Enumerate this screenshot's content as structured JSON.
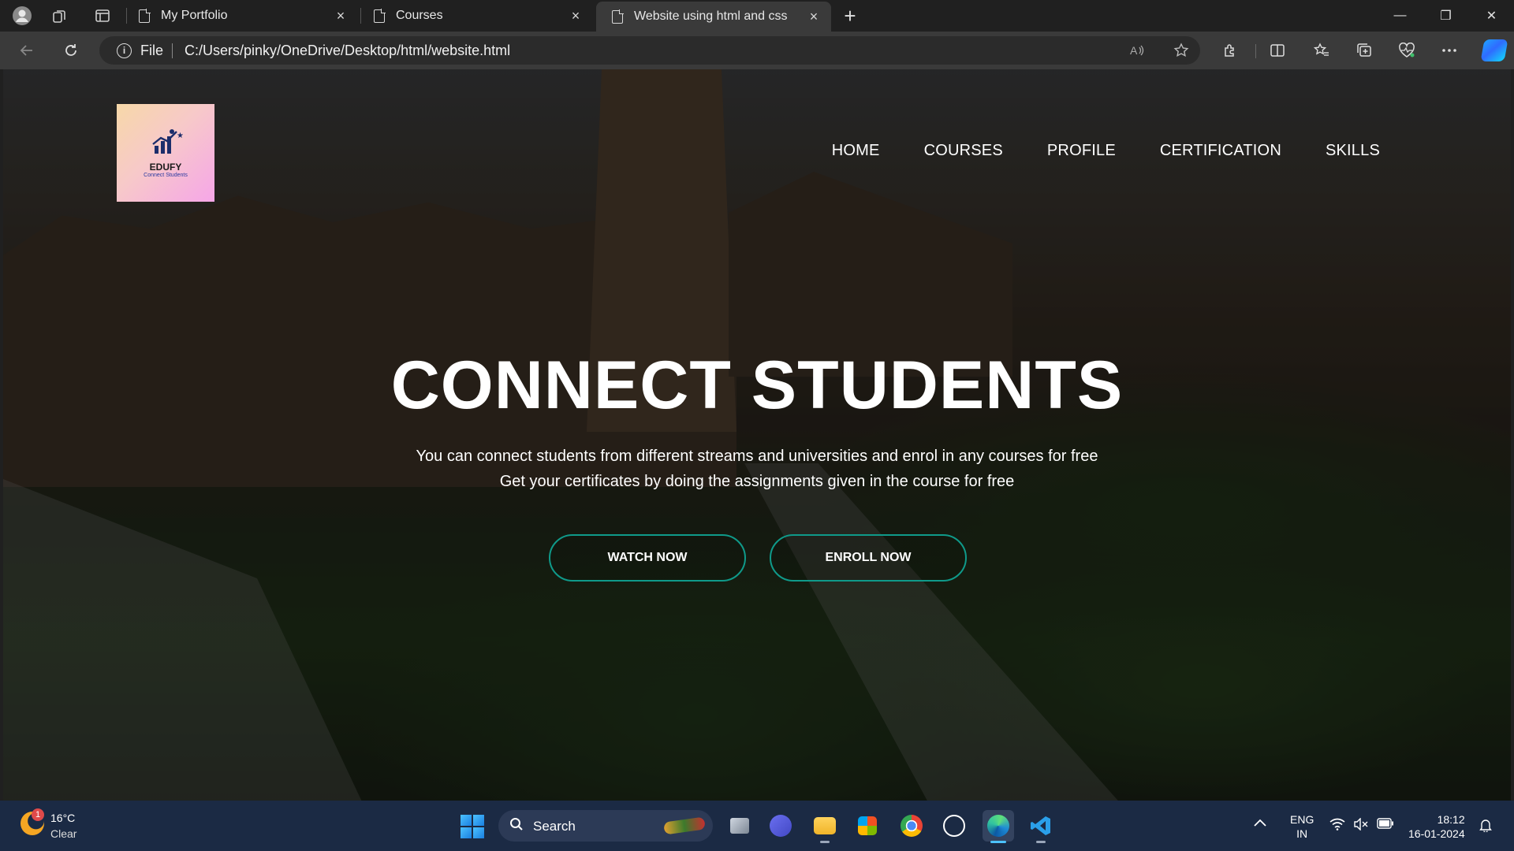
{
  "browser": {
    "tabs": [
      {
        "title": "My Portfolio",
        "close": "×"
      },
      {
        "title": "Courses",
        "close": "×"
      },
      {
        "title": "Website using html and css",
        "close": "×"
      }
    ],
    "new_tab": "+",
    "window_controls": {
      "minimize": "—",
      "restore": "❐",
      "close": "✕"
    },
    "address": {
      "scheme_label": "File",
      "url": "C:/Users/pinky/OneDrive/Desktop/html/website.html"
    },
    "icons": [
      "profile-icon",
      "workspaces-icon",
      "tab-actions-icon",
      "back-icon",
      "refresh-icon",
      "info-icon",
      "read-aloud-icon",
      "favorite-icon",
      "extensions-icon",
      "split-screen-icon",
      "favorites-icon",
      "collections-icon",
      "browser-essentials-icon",
      "more-icon",
      "copilot-icon"
    ]
  },
  "page": {
    "logo": {
      "brand": "EDUFY",
      "tagline": "Connect Students"
    },
    "nav": [
      "HOME",
      "COURSES",
      "PROFILE",
      "CERTIFICATION",
      "SKILLS"
    ],
    "hero": {
      "title": "CONNECT STUDENTS",
      "line1": "You can connect students from different streams and universities and enrol in any courses for free",
      "line2": "Get your certificates by doing the assignments given in the course for free"
    },
    "buttons": {
      "watch": "WATCH NOW",
      "enroll": "ENROLL NOW"
    },
    "accent_color": "#0f9a8a"
  },
  "taskbar": {
    "weather": {
      "temp": "16°C",
      "condition": "Clear",
      "badge": "1"
    },
    "search_label": "Search",
    "language": {
      "line1": "ENG",
      "line2": "IN"
    },
    "clock": {
      "time": "18:12",
      "date": "16-01-2024"
    }
  }
}
